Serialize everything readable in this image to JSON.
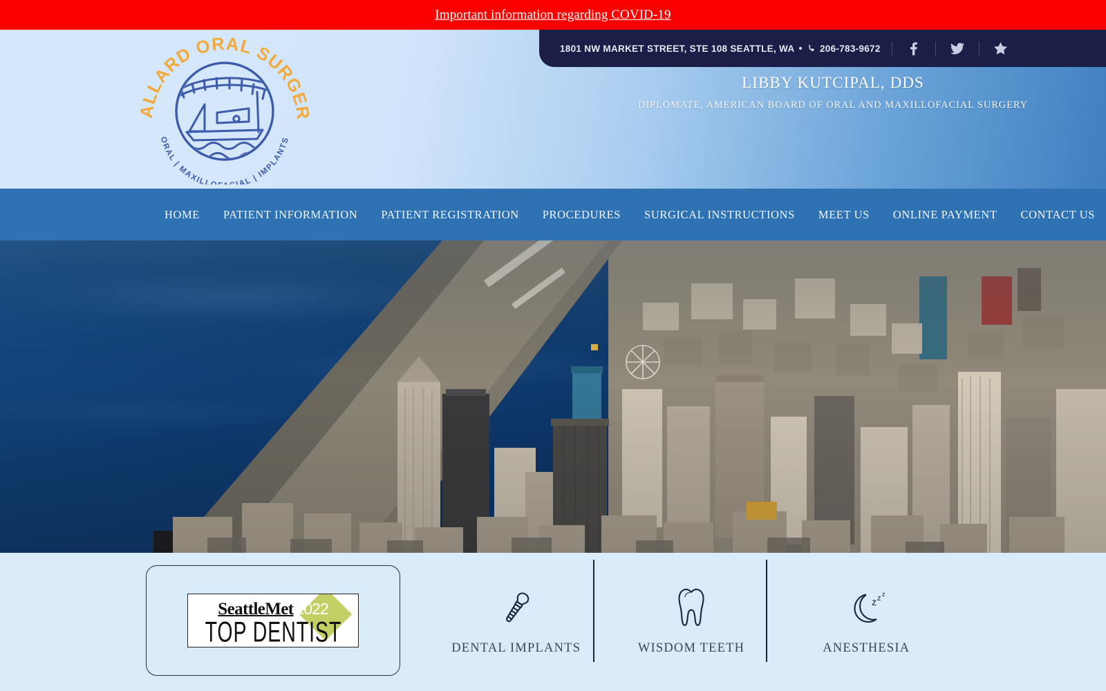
{
  "covid_banner": {
    "link_text": "Important information regarding COVID-19",
    "background": "#fb0000"
  },
  "header": {
    "logo": {
      "arc_top": "BALLARD ORAL SURGERY",
      "arc_bottom": "ORAL | MAXILLOFACIAL | IMPLANTS",
      "arc_top_color": "#f4a93c",
      "arc_bottom_color": "#3d5bab",
      "emblem": "fishing-boat-and-bridge"
    },
    "contact": {
      "address": "1801 NW MARKET STREET, STE 108 SEATTLE, WA",
      "separator": "•",
      "phone": "206-783-9672",
      "phone_icon": "phone-icon",
      "social": [
        {
          "name": "facebook-icon",
          "label": "f"
        },
        {
          "name": "twitter-icon",
          "label": "Twitter"
        },
        {
          "name": "star-review-icon",
          "label": "Reviews"
        }
      ],
      "background": "#1b1e46"
    },
    "doctor_name": "LIBBY KUTCIPAL, DDS",
    "doctor_credentials": "DIPLOMATE, AMERICAN BOARD OF ORAL AND MAXILLOFACIAL SURGERY"
  },
  "nav": {
    "background": "#2e72b4",
    "items": [
      {
        "label": "HOME"
      },
      {
        "label": "PATIENT INFORMATION"
      },
      {
        "label": "PATIENT REGISTRATION"
      },
      {
        "label": "PROCEDURES"
      },
      {
        "label": "SURGICAL INSTRUCTIONS"
      },
      {
        "label": "MEET US"
      },
      {
        "label": "ONLINE PAYMENT"
      },
      {
        "label": "CONTACT US"
      }
    ]
  },
  "hero": {
    "description": "Aerial photograph of downtown Seattle skyline with Puget Sound waterfront",
    "water_color": "#0c3a71"
  },
  "services": {
    "background": "#d9eaf9",
    "award_badge": {
      "publication": "SeattleMet",
      "year": "2022",
      "title": "TOP DENTIST",
      "accent_color": "#c3cf64"
    },
    "tiles": [
      {
        "label": "DENTAL IMPLANTS",
        "icon": "dental-implant-icon"
      },
      {
        "label": "WISDOM TEETH",
        "icon": "tooth-icon"
      },
      {
        "label": "ANESTHESIA",
        "icon": "moon-sleep-icon"
      }
    ]
  }
}
